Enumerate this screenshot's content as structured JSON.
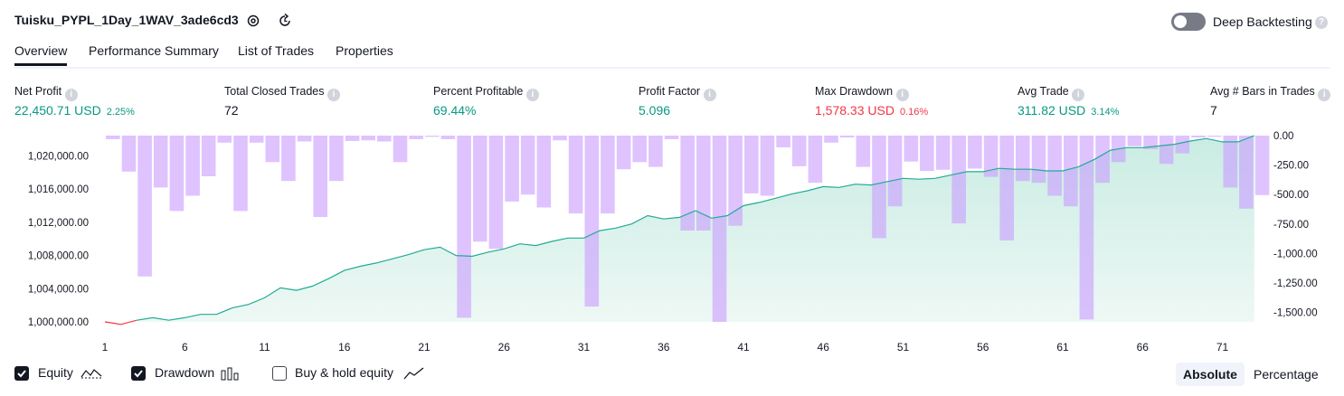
{
  "header": {
    "title": "Tuisku_PYPL_1Day_1WAV_3ade6cd3",
    "deep_backtesting_label": "Deep Backtesting",
    "deep_backtesting_enabled": false
  },
  "tabs": [
    {
      "label": "Overview",
      "active": true
    },
    {
      "label": "Performance Summary",
      "active": false
    },
    {
      "label": "List of Trades",
      "active": false
    },
    {
      "label": "Properties",
      "active": false
    }
  ],
  "metrics": [
    {
      "label": "Net Profit",
      "value": "22,450.71 USD",
      "pct": "2.25%",
      "color": "#089981"
    },
    {
      "label": "Total Closed Trades",
      "value": "72",
      "pct": "",
      "color": "#131722"
    },
    {
      "label": "Percent Profitable",
      "value": "69.44%",
      "pct": "",
      "color": "#089981"
    },
    {
      "label": "Profit Factor",
      "value": "5.096",
      "pct": "",
      "color": "#089981"
    },
    {
      "label": "Max Drawdown",
      "value": "1,578.33 USD",
      "pct": "0.16%",
      "color": "#f23645"
    },
    {
      "label": "Avg Trade",
      "value": "311.82 USD",
      "pct": "3.14%",
      "color": "#089981"
    },
    {
      "label": "Avg # Bars in Trades",
      "value": "7",
      "pct": "",
      "color": "#131722"
    }
  ],
  "legend": {
    "equity": {
      "label": "Equity",
      "checked": true
    },
    "drawdown": {
      "label": "Drawdown",
      "checked": true
    },
    "buy_hold": {
      "label": "Buy & hold equity",
      "checked": false
    }
  },
  "view_mode": {
    "absolute": "Absolute",
    "percentage": "Percentage",
    "selected": "Absolute"
  },
  "chart_data": {
    "type": "area",
    "colors": {
      "equity_line": "#22ab94",
      "equity_fill": "#c9ece3",
      "drawdown": "#c99bff",
      "loss_line": "#f23645"
    },
    "x_ticks": [
      1,
      6,
      11,
      16,
      21,
      26,
      31,
      36,
      41,
      46,
      51,
      56,
      61,
      66,
      71
    ],
    "left_axis": {
      "ticks": [
        "1,000,000.00",
        "1,004,000.00",
        "1,008,000.00",
        "1,012,000.00",
        "1,016,000.00",
        "1,020,000.00"
      ],
      "tick_values": [
        1000000,
        1004000,
        1008000,
        1012000,
        1016000,
        1020000
      ],
      "ylim": [
        1000000,
        1022450
      ]
    },
    "right_axis": {
      "ticks": [
        "0.00",
        "-250.00",
        "-500.00",
        "-750.00",
        "-1,000.00",
        "-1,250.00",
        "-1,500.00"
      ],
      "tick_values": [
        0,
        -250,
        -500,
        -750,
        -1000,
        -1250,
        -1500
      ],
      "ylim": [
        -1580,
        0
      ]
    },
    "series": [
      {
        "name": "Equity",
        "axis": "left",
        "values": [
          1000000,
          999700,
          1000200,
          1000500,
          1000200,
          1000500,
          1000900,
          1000900,
          1001700,
          1002100,
          1002900,
          1004100,
          1003800,
          1004300,
          1005200,
          1006200,
          1006700,
          1007100,
          1007600,
          1008100,
          1008700,
          1009000,
          1008000,
          1007900,
          1008400,
          1008800,
          1009400,
          1009200,
          1009700,
          1010100,
          1010100,
          1011000,
          1011300,
          1011800,
          1012800,
          1012400,
          1012600,
          1013400,
          1012500,
          1012800,
          1014000,
          1014400,
          1014900,
          1015400,
          1015800,
          1016300,
          1016200,
          1016600,
          1016500,
          1016900,
          1017300,
          1017200,
          1017300,
          1017700,
          1018100,
          1018100,
          1018500,
          1018400,
          1018400,
          1018200,
          1018200,
          1018700,
          1019600,
          1020700,
          1021000,
          1021000,
          1021200,
          1021400,
          1021800,
          1022100,
          1021700,
          1021700,
          1022450
        ]
      },
      {
        "name": "Drawdown",
        "axis": "right",
        "type": "bar",
        "values": [
          -30,
          -305,
          -1195,
          -440,
          -640,
          -510,
          -345,
          -60,
          -640,
          -60,
          -225,
          -385,
          -50,
          -690,
          -385,
          -45,
          -40,
          -50,
          -225,
          -30,
          -10,
          -30,
          -1545,
          -900,
          -960,
          -560,
          -500,
          -610,
          -40,
          -660,
          -1450,
          -660,
          -285,
          -225,
          -265,
          -30,
          -805,
          -805,
          -1580,
          -765,
          -490,
          -510,
          -100,
          -260,
          -400,
          -60,
          -15,
          -265,
          -870,
          -600,
          -220,
          -300,
          -290,
          -745,
          -280,
          -350,
          -890,
          -385,
          -400,
          -510,
          -600,
          -1560,
          -400,
          -225,
          -90,
          -115,
          -240,
          -150,
          -15,
          -10,
          -440,
          -620,
          -505,
          -590
        ]
      }
    ]
  }
}
